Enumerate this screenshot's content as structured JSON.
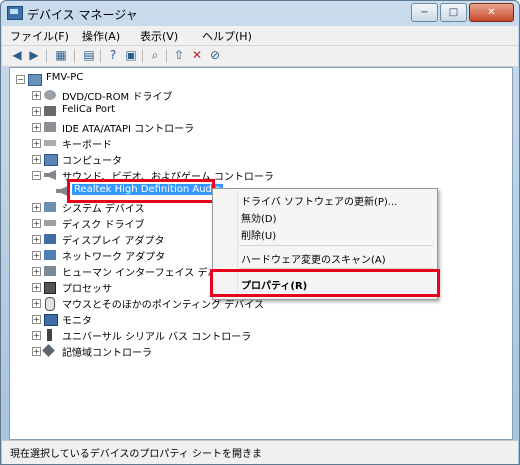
{
  "window": {
    "title": "デバイス マネージャ",
    "minimize": "−",
    "maximize": "□",
    "close": "✕"
  },
  "menu": [
    "ファイル(F)",
    "操作(A)",
    "表示(V)",
    "ヘルプ(H)"
  ],
  "toolbar_icons": [
    "back-icon",
    "forward-icon",
    "show-hide-tree-icon",
    "properties-icon",
    "help-icon",
    "view-icon",
    "scan-icon",
    "update-driver-icon",
    "uninstall-icon",
    "disable-icon"
  ],
  "tree": {
    "root": "FMV-PC",
    "items": [
      "DVD/CD-ROM ドライブ",
      "FeliCa Port",
      "IDE ATA/ATAPI コントローラ",
      "キーボード",
      "コンピュータ",
      "サウンド、ビデオ、およびゲーム コントローラ",
      "Realtek High Definition Audio",
      "システム デバイス",
      "ディスク ドライブ",
      "ディスプレイ アダプタ",
      "ネットワーク アダプタ",
      "ヒューマン インターフェイス デバイス",
      "プロセッサ",
      "マウスとそのほかのポインティング デバイス",
      "モニタ",
      "ユニバーサル シリアル バス コントローラ",
      "記憶域コントローラ"
    ]
  },
  "context_menu": {
    "update": "ドライバ ソフトウェアの更新(P)...",
    "disable": "無効(D)",
    "delete": "削除(U)",
    "scan": "ハードウェア変更のスキャン(A)",
    "properties": "プロパティ(R)"
  },
  "status": "現在選択しているデバイスのプロパティ シートを開きま",
  "highlight_color": "#e8001c",
  "selection_color": "#3399ff"
}
